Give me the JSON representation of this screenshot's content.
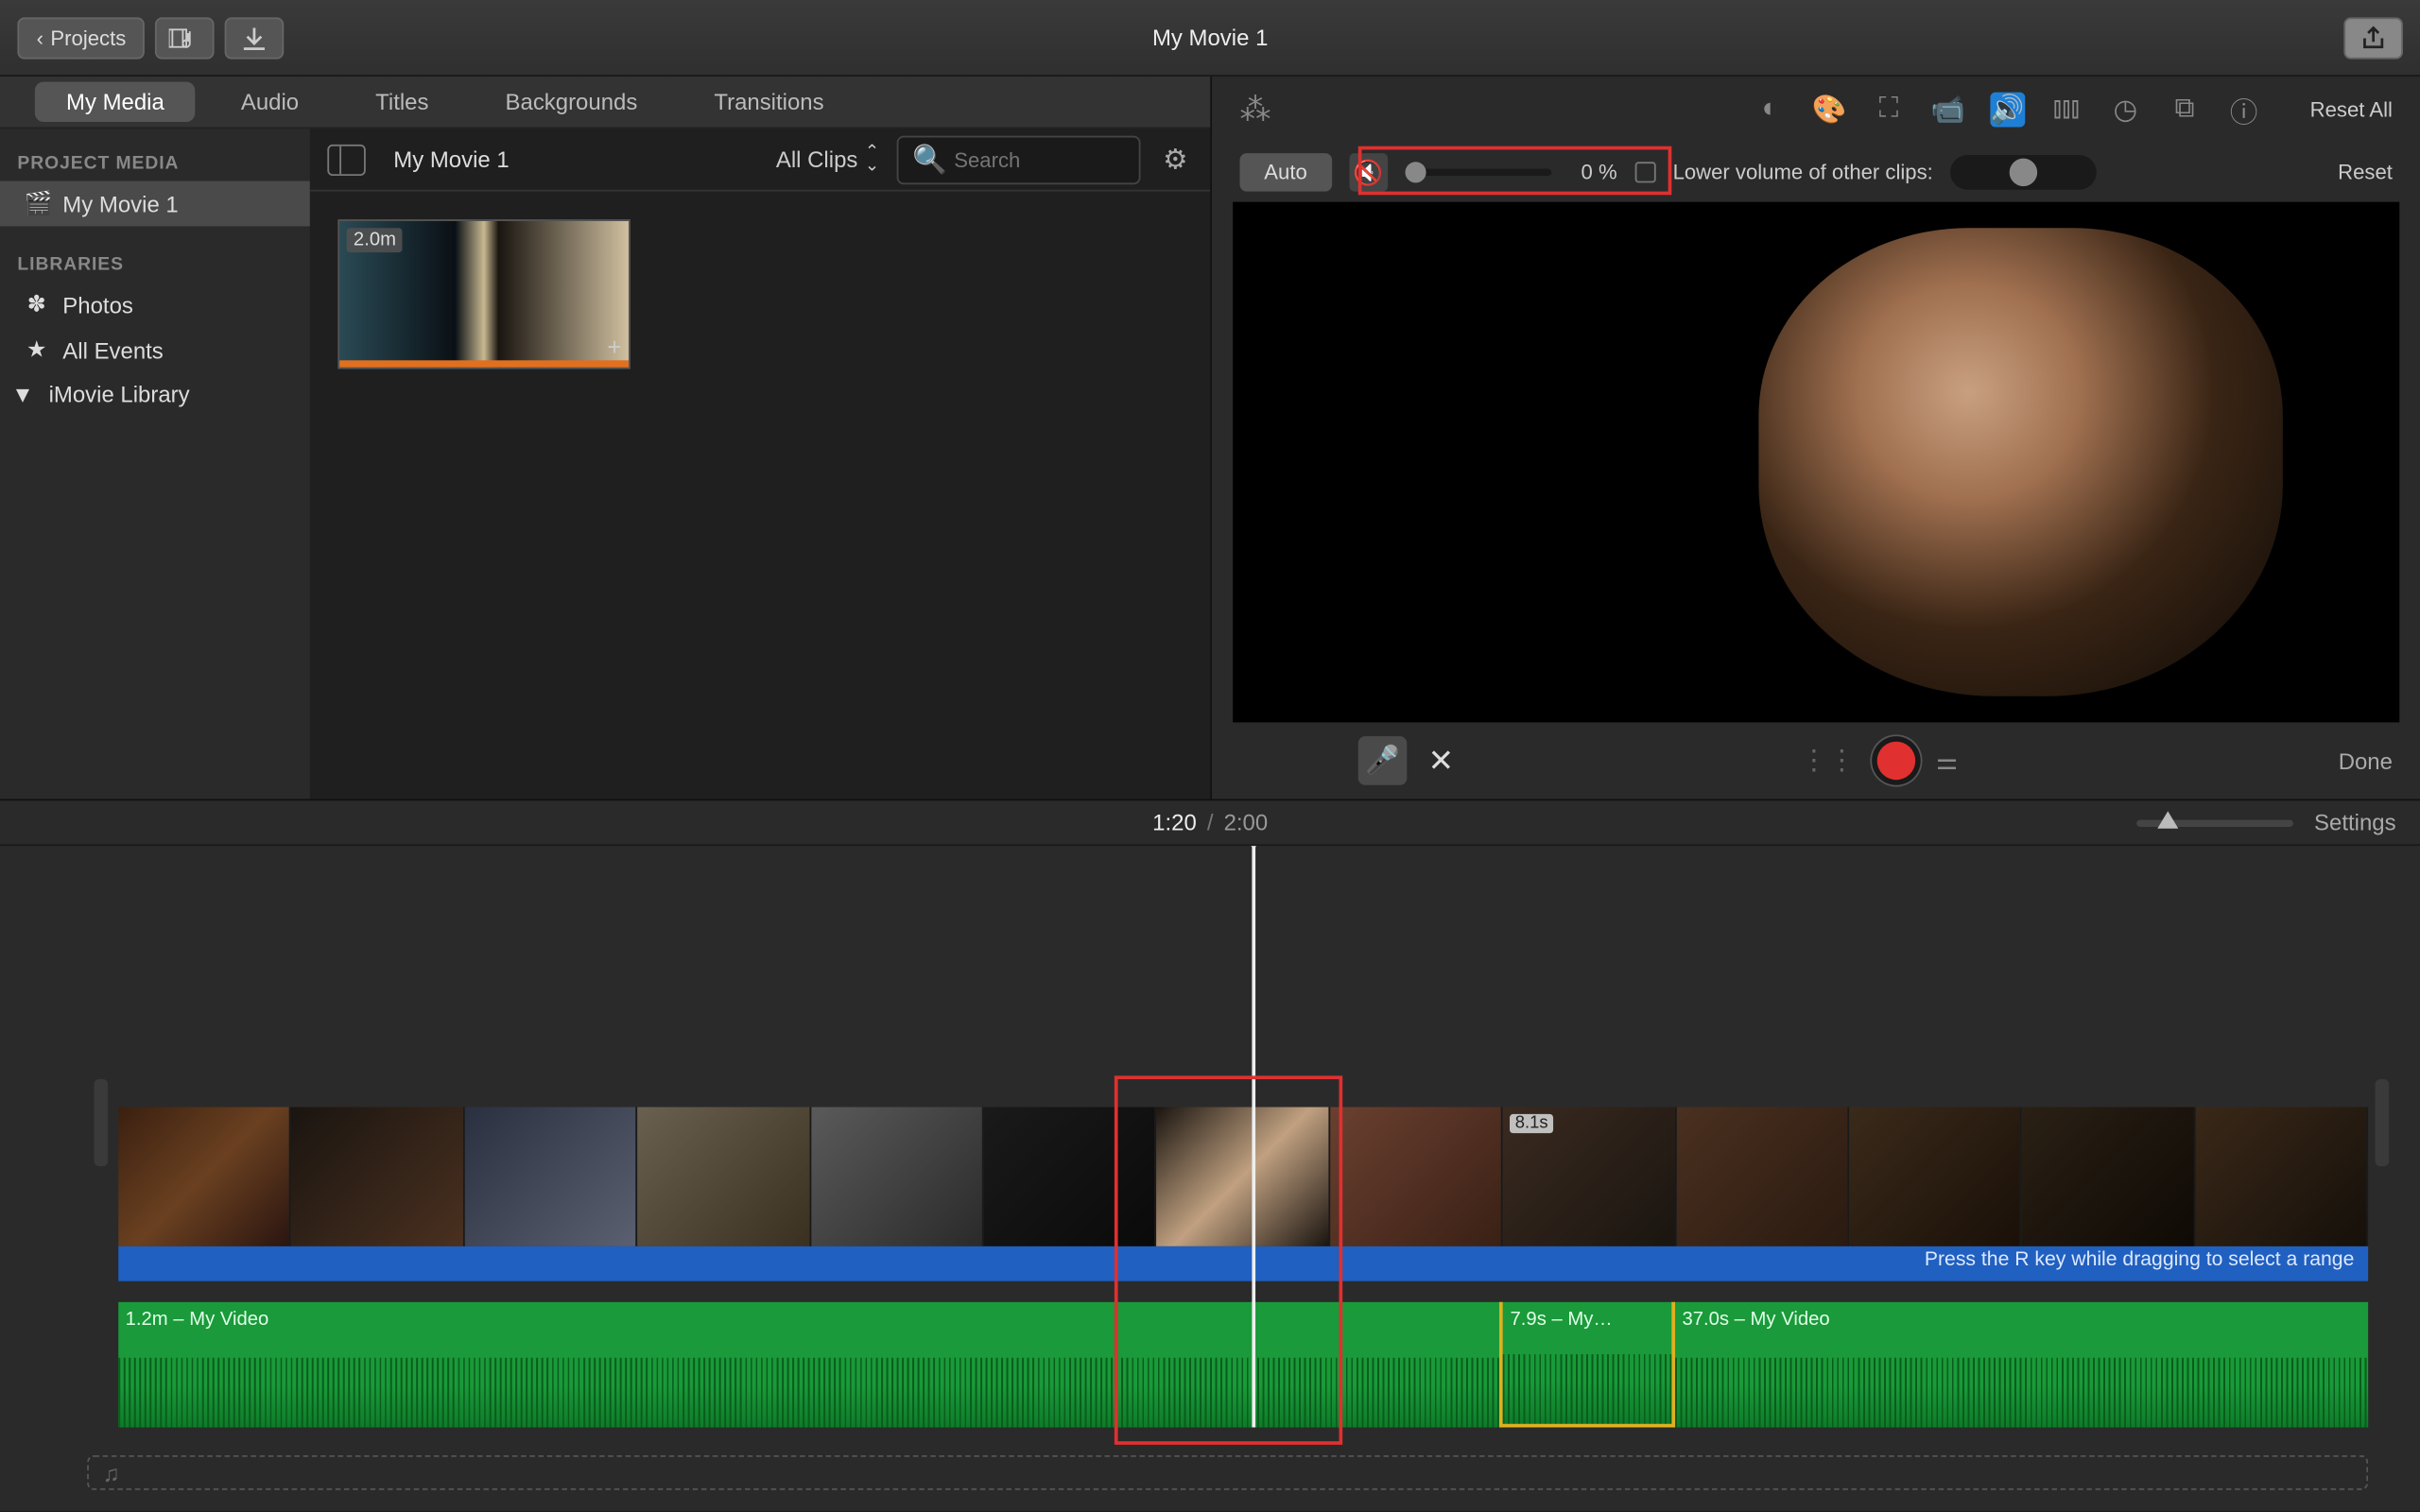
{
  "titlebar": {
    "back_label": "Projects",
    "title": "My Movie 1"
  },
  "tabs": {
    "my_media": "My Media",
    "audio": "Audio",
    "titles": "Titles",
    "backgrounds": "Backgrounds",
    "transitions": "Transitions"
  },
  "sidebar": {
    "project_media_header": "PROJECT MEDIA",
    "project_name": "My Movie 1",
    "libraries_header": "LIBRARIES",
    "photos": "Photos",
    "all_events": "All Events",
    "imovie_library": "iMovie Library"
  },
  "media_top": {
    "breadcrumb": "My Movie 1",
    "all_clips": "All Clips",
    "search_placeholder": "Search"
  },
  "clip": {
    "duration": "2.0m"
  },
  "viewer": {
    "reset_all": "Reset All",
    "auto": "Auto",
    "volume_pct": "0 %",
    "lower_label": "Lower volume of other clips:",
    "reset": "Reset",
    "done": "Done"
  },
  "timeline": {
    "current": "1:20",
    "total": "2:00",
    "settings": "Settings",
    "hint": "Press the R key while dragging to select a range",
    "selected_dur": "8.1s",
    "audio1_label": "1.2m – My Video",
    "audio2_label": "7.9s – My…",
    "audio3_label": "37.0s – My Video"
  }
}
